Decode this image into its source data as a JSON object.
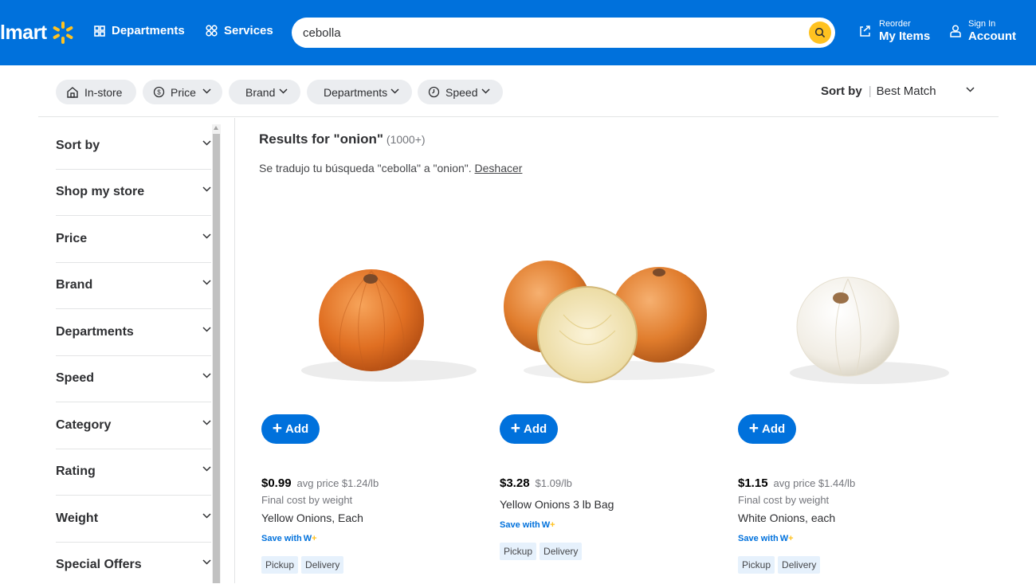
{
  "header": {
    "logo_text": "lmart",
    "departments_label": "Departments",
    "services_label": "Services",
    "search_value": "cebolla",
    "reorder_small": "Reorder",
    "reorder_big": "My Items",
    "signin_small": "Sign In",
    "signin_big": "Account",
    "accent_color": "#0071dc",
    "spark_color": "#ffc220"
  },
  "filters": {
    "chips": [
      "In-store",
      "Price",
      "Brand",
      "Departments",
      "Speed"
    ],
    "sort_label": "Sort by",
    "sort_value": "Best Match"
  },
  "sidebar": {
    "items": [
      "Sort by",
      "Shop my store",
      "Price",
      "Brand",
      "Departments",
      "Speed",
      "Category",
      "Rating",
      "Weight",
      "Special Offers"
    ]
  },
  "results": {
    "title": "Results for \"onion\"",
    "count": "(1000+)",
    "translated_prefix": "Se tradujo tu búsqueda \"cebolla\" a \"onion\".",
    "undo_label": "Deshacer"
  },
  "products": [
    {
      "price": "$0.99",
      "avg_price": "avg price $1.24/lb",
      "final_cost": "Final cost by weight",
      "name": "Yellow Onions, Each",
      "save_with": "Save with",
      "tags": [
        "Pickup",
        "Delivery"
      ],
      "add_label": "Add",
      "image_icon": "yellow-onion"
    },
    {
      "price": "$3.28",
      "avg_price": "$1.09/lb",
      "name": "Yellow Onions 3 lb Bag",
      "save_with": "Save with",
      "tags": [
        "Pickup",
        "Delivery"
      ],
      "add_label": "Add",
      "image_icon": "yellow-onions-bag"
    },
    {
      "price": "$1.15",
      "avg_price": "avg price $1.44/lb",
      "final_cost": "Final cost by weight",
      "name": "White Onions, each",
      "save_with": "Save with",
      "tags": [
        "Pickup",
        "Delivery"
      ],
      "add_label": "Add",
      "image_icon": "white-onion"
    }
  ]
}
